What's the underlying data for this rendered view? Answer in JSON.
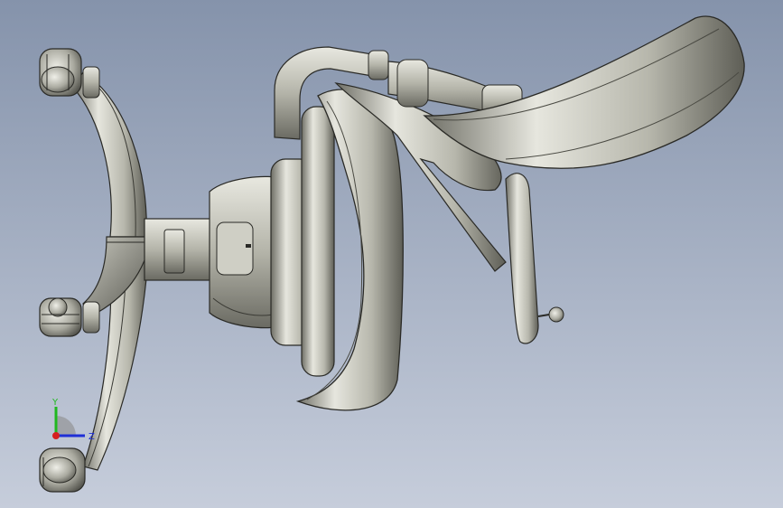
{
  "viewport": {
    "background_top": "#8593ab",
    "background_bottom": "#c6cddb"
  },
  "model": {
    "shade_light": "#e4e4dc",
    "shade_mid": "#b9b9ae",
    "shade_dark": "#6f6f66",
    "edge_color": "#2a2a26"
  },
  "triad": {
    "y_label": "Y",
    "z_label": "Z",
    "y_color": "#1fb81f",
    "z_color": "#1f2fd6",
    "x_color": "#d61f1f"
  }
}
